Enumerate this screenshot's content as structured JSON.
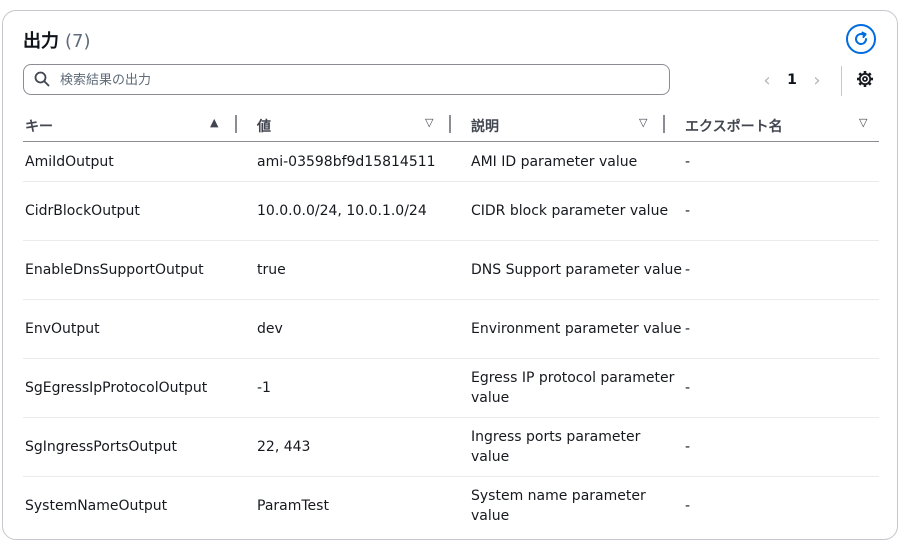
{
  "header": {
    "title": "出力",
    "count": "(7)"
  },
  "icons": {
    "refresh": "refresh-icon",
    "search": "search-icon",
    "settings": "gear-icon",
    "prev": "chevron-left-icon",
    "next": "chevron-right-icon"
  },
  "colors": {
    "accent": "#006ce0",
    "border": "#c6c6cd",
    "text": "#16191f"
  },
  "search": {
    "placeholder": "検索結果の出力",
    "value": ""
  },
  "pagination": {
    "current_page": "1",
    "prev": "‹",
    "next": "›"
  },
  "table": {
    "columns": [
      {
        "label": "キー",
        "sort": "▲"
      },
      {
        "label": "値",
        "sort": "▽"
      },
      {
        "label": "説明",
        "sort": "▽"
      },
      {
        "label": "エクスポート名",
        "sort": "▽"
      }
    ],
    "rows": [
      {
        "key": "AmiIdOutput",
        "value": "ami-03598bf9d15814511",
        "description": "AMI ID parameter value",
        "export": "-"
      },
      {
        "key": "CidrBlockOutput",
        "value": "10.0.0.0/24, 10.0.1.0/24",
        "description": "CIDR block parameter value",
        "export": "-"
      },
      {
        "key": "EnableDnsSupportOutput",
        "value": "true",
        "description": "DNS Support parameter value",
        "export": "-"
      },
      {
        "key": "EnvOutput",
        "value": "dev",
        "description": "Environment parameter value",
        "export": "-"
      },
      {
        "key": "SgEgressIpProtocolOutput",
        "value": "-1",
        "description": "Egress IP protocol parameter value",
        "export": "-"
      },
      {
        "key": "SgIngressPortsOutput",
        "value": "22, 443",
        "description": "Ingress ports parameter value",
        "export": "-"
      },
      {
        "key": "SystemNameOutput",
        "value": "ParamTest",
        "description": "System name parameter value",
        "export": "-"
      }
    ]
  }
}
